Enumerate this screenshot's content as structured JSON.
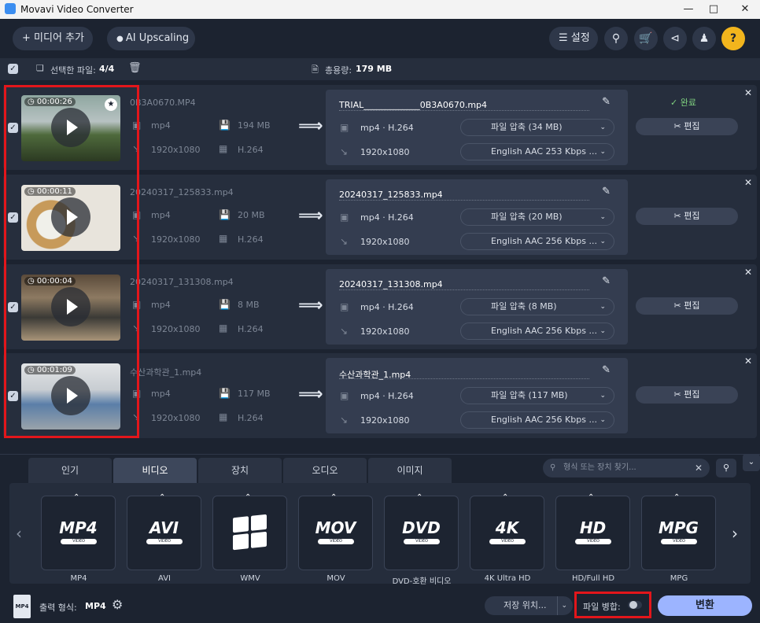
{
  "app": {
    "title": "Movavi Video Converter"
  },
  "toolbar": {
    "add_media": "미디어 추가",
    "ai_upscaling": "AI Upscaling",
    "settings": "설정"
  },
  "selection": {
    "label": "선택한 파일:",
    "count": "4/4",
    "total_label": "총용량:",
    "total_size": "179 MB"
  },
  "files": [
    {
      "duration": "00:00:26",
      "name": "0B3A0670.MP4",
      "src_format": "mp4",
      "src_size": "194 MB",
      "src_res": "1920x1080",
      "src_codec": "H.264",
      "out_name": "TRIAL_____________0B3A0670.mp4",
      "out_format": "mp4 · H.264",
      "out_res": "1920x1080",
      "compress": "파일 압축 (34 MB)",
      "audio": "English AAC 253 Kbps ...",
      "status": "완료",
      "starred": true
    },
    {
      "duration": "00:00:11",
      "name": "20240317_125833.mp4",
      "src_format": "mp4",
      "src_size": "20 MB",
      "src_res": "1920x1080",
      "src_codec": "H.264",
      "out_name": "20240317_125833.mp4",
      "out_format": "mp4 · H.264",
      "out_res": "1920x1080",
      "compress": "파일 압축 (20 MB)",
      "audio": "English AAC 256 Kbps ...",
      "status": "",
      "starred": false
    },
    {
      "duration": "00:00:04",
      "name": "20240317_131308.mp4",
      "src_format": "mp4",
      "src_size": "8 MB",
      "src_res": "1920x1080",
      "src_codec": "H.264",
      "out_name": "20240317_131308.mp4",
      "out_format": "mp4 · H.264",
      "out_res": "1920x1080",
      "compress": "파일 압축 (8 MB)",
      "audio": "English AAC 256 Kbps ...",
      "status": "",
      "starred": false
    },
    {
      "duration": "00:01:09",
      "name": "수산과학관_1.mp4",
      "src_format": "mp4",
      "src_size": "117 MB",
      "src_res": "1920x1080",
      "src_codec": "H.264",
      "out_name": "수산과학관_1.mp4",
      "out_format": "mp4 · H.264",
      "out_res": "1920x1080",
      "compress": "파일 압축 (117 MB)",
      "audio": "English AAC 256 Kbps ...",
      "status": "",
      "starred": false
    }
  ],
  "edit_label": "편집",
  "tabs": [
    "인기",
    "비디오",
    "장치",
    "오디오",
    "이미지"
  ],
  "active_tab": "비디오",
  "search": {
    "placeholder": "형식 또는 장치 찾기..."
  },
  "formats": [
    {
      "logo": "MP4",
      "badge": "VIDEO",
      "label": "MP4"
    },
    {
      "logo": "AVI",
      "badge": "VIDEO",
      "label": "AVI"
    },
    {
      "logo": "",
      "badge": "",
      "label": "WMV"
    },
    {
      "logo": "MOV",
      "badge": "VIDEO",
      "label": "MOV"
    },
    {
      "logo": "DVD",
      "badge": "VIDEO",
      "label": "DVD-호환 비디오"
    },
    {
      "logo": "4K",
      "badge": "VIDEO",
      "label": "4K Ultra HD"
    },
    {
      "logo": "HD",
      "badge": "VIDEO",
      "label": "HD/Full HD"
    },
    {
      "logo": "MPG",
      "badge": "VIDEO",
      "label": "MPG"
    }
  ],
  "output": {
    "label": "출력 형식:",
    "format": "MP4",
    "icon_text": "MP4"
  },
  "save_location": "저장 위치...",
  "merge_label": "파일 병합:",
  "convert_label": "변환",
  "colors": {
    "accent": "#9cb4ff",
    "highlight": "#e3161b",
    "done": "#7fd17f"
  }
}
